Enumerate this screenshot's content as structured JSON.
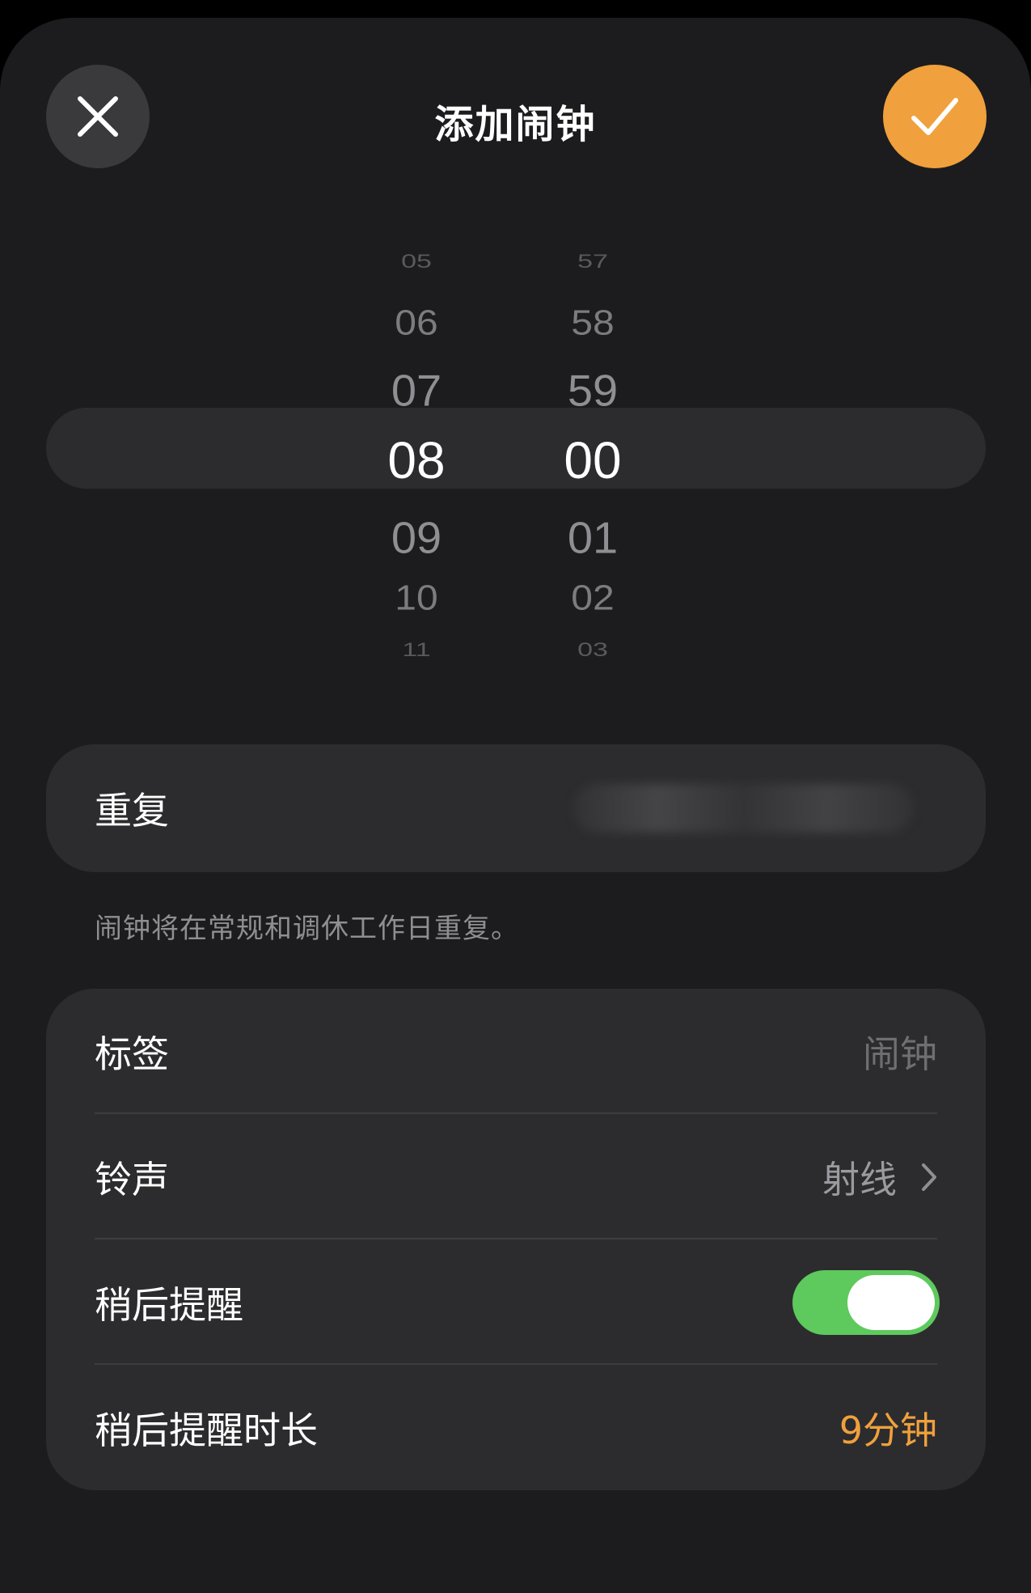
{
  "header": {
    "title": "添加闹钟",
    "close_icon": "close-icon",
    "confirm_icon": "checkmark-icon",
    "accent_color": "#f0a03c"
  },
  "picker": {
    "hours": [
      "05",
      "06",
      "07",
      "08",
      "09",
      "10",
      "11"
    ],
    "minutes": [
      "57",
      "58",
      "59",
      "00",
      "01",
      "02",
      "03"
    ],
    "selected_hour": "08",
    "selected_minute": "00"
  },
  "repeat": {
    "label": "重复",
    "footnote": "闹钟将在常规和调休工作日重复。"
  },
  "settings": {
    "label_row": {
      "label": "标签",
      "value": "闹钟"
    },
    "ringtone_row": {
      "label": "铃声",
      "value": "射线"
    },
    "snooze_row": {
      "label": "稍后提醒",
      "enabled": true,
      "toggle_color": "#5ec95d"
    },
    "snooze_duration_row": {
      "label": "稍后提醒时长",
      "value": "9分钟",
      "value_color": "#f0a03c"
    }
  }
}
